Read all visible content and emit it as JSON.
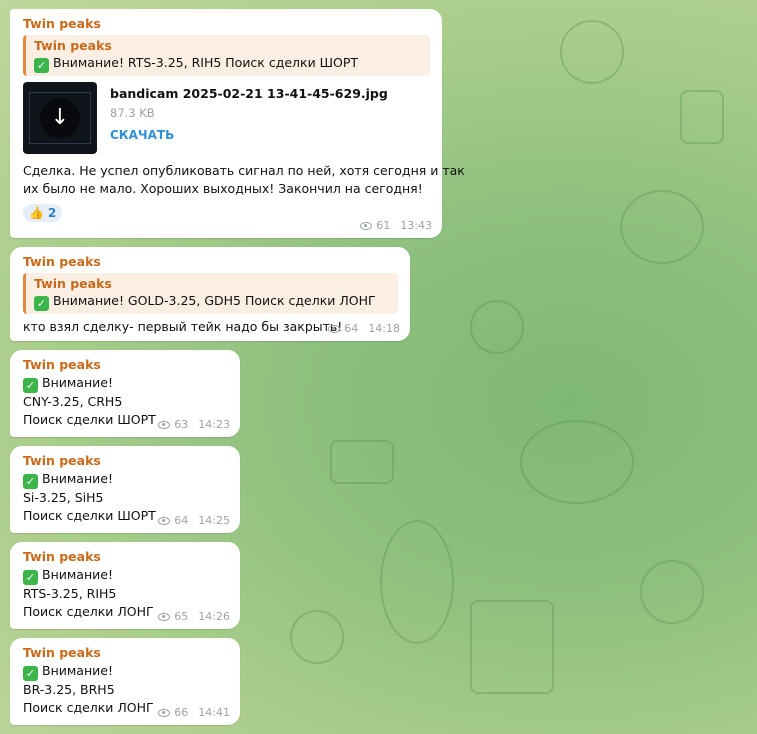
{
  "messages": [
    {
      "sender": "Twin peaks",
      "reply": {
        "name": "Twin peaks",
        "text": "Внимание! RTS-3.25, RIH5 Поиск сделки ШОРТ"
      },
      "file": {
        "name": "bandicam 2025-02-21 13-41-45-629.jpg",
        "size": "87.3 KB",
        "action": "СКАЧАТЬ"
      },
      "text_lines": [
        "Сделка. Не успел опубликовать сигнал по ней, хотя сегодня и так",
        "их было не мало. Хороших выходных! Закончил на сегодня!"
      ],
      "reaction": {
        "emoji": "👍",
        "count": "2"
      },
      "views": "61",
      "time": "13:43"
    },
    {
      "sender": "Twin peaks",
      "reply": {
        "name": "Twin peaks",
        "text": "Внимание! GOLD-3.25, GDH5 Поиск сделки ЛОНГ"
      },
      "text_lines": [
        "кто взял сделку- первый тейк надо бы закрыть!"
      ],
      "views": "64",
      "time": "14:18"
    },
    {
      "sender": "Twin peaks",
      "lines": [
        "Внимание!",
        "CNY-3.25, CRH5",
        "Поиск сделки ШОРТ"
      ],
      "views": "63",
      "time": "14:23"
    },
    {
      "sender": "Twin peaks",
      "lines": [
        "Внимание!",
        "Si-3.25, SiH5",
        "Поиск сделки ШОРТ"
      ],
      "views": "64",
      "time": "14:25"
    },
    {
      "sender": "Twin peaks",
      "lines": [
        "Внимание!",
        "RTS-3.25, RIH5",
        "Поиск сделки ЛОНГ"
      ],
      "views": "65",
      "time": "14:26"
    },
    {
      "sender": "Twin peaks",
      "lines": [
        "Внимание!",
        "BR-3.25, BRH5",
        "Поиск сделки ЛОНГ"
      ],
      "views": "66",
      "time": "14:41"
    }
  ],
  "icons": {
    "check": "check-mark-icon",
    "views": "eye-icon",
    "download": "download-arrow-icon"
  },
  "colors": {
    "sender": "#c9691a",
    "link": "#2f8fd6",
    "check": "#3bb44a"
  }
}
